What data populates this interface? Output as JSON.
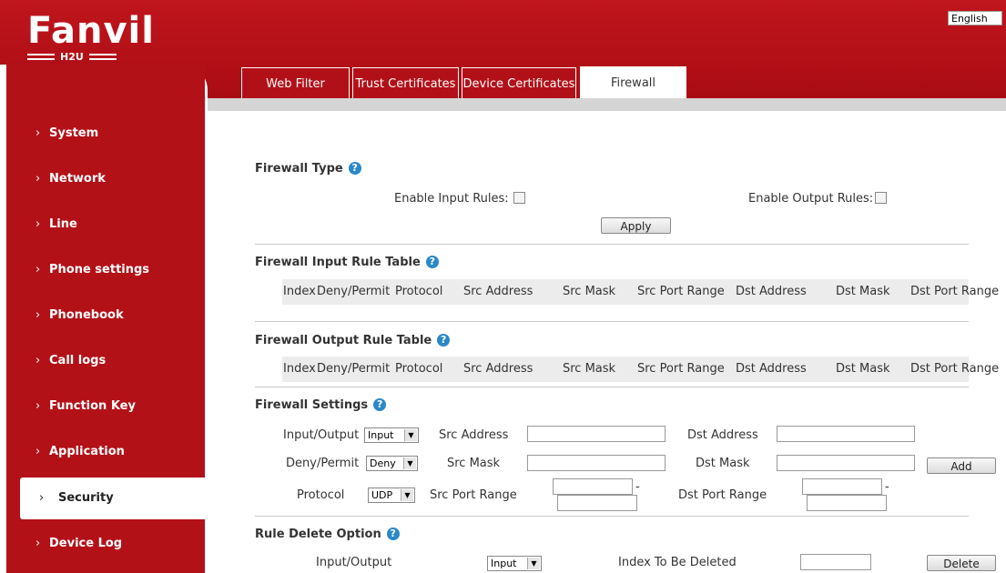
{
  "header": {
    "logo": "Fanvil",
    "logo_sub": "H2U",
    "language": "English"
  },
  "tabs": [
    {
      "label": "Web Filter"
    },
    {
      "label": "Trust Certificates"
    },
    {
      "label": "Device Certificates"
    },
    {
      "label": "Firewall"
    }
  ],
  "sidebar": {
    "items": [
      {
        "label": "System"
      },
      {
        "label": "Network"
      },
      {
        "label": "Line"
      },
      {
        "label": "Phone settings"
      },
      {
        "label": "Phonebook"
      },
      {
        "label": "Call logs"
      },
      {
        "label": "Function Key"
      },
      {
        "label": "Application"
      },
      {
        "label": "Security"
      },
      {
        "label": "Device Log"
      }
    ],
    "active": "Security",
    "chevron": "›"
  },
  "firewall_type": {
    "title": "Firewall Type",
    "enable_input_label": "Enable Input Rules:",
    "enable_output_label": "Enable Output Rules:",
    "apply_label": "Apply"
  },
  "input_table": {
    "title": "Firewall Input Rule Table",
    "columns": [
      "Index",
      "Deny/Permit",
      "Protocol",
      "Src Address",
      "Src Mask",
      "Src Port Range",
      "Dst Address",
      "Dst Mask",
      "Dst Port Range"
    ]
  },
  "output_table": {
    "title": "Firewall Output Rule Table",
    "columns": [
      "Index",
      "Deny/Permit",
      "Protocol",
      "Src Address",
      "Src Mask",
      "Src Port Range",
      "Dst Address",
      "Dst Mask",
      "Dst Port Range"
    ]
  },
  "settings": {
    "title": "Firewall Settings",
    "input_output_label": "Input/Output",
    "input_output_value": "Input",
    "deny_permit_label": "Deny/Permit",
    "deny_permit_value": "Deny",
    "protocol_label": "Protocol",
    "protocol_value": "UDP",
    "src_address_label": "Src Address",
    "src_mask_label": "Src Mask",
    "src_port_range_label": "Src Port Range",
    "dst_address_label": "Dst Address",
    "dst_mask_label": "Dst Mask",
    "dst_port_range_label": "Dst Port Range",
    "range_sep": "-",
    "add_label": "Add"
  },
  "rule_delete": {
    "title": "Rule Delete Option",
    "input_output_label": "Input/Output",
    "input_output_value": "Input",
    "index_label": "Index To Be Deleted",
    "delete_label": "Delete"
  },
  "help_glyph": "?",
  "dropdown_glyph": "▼"
}
